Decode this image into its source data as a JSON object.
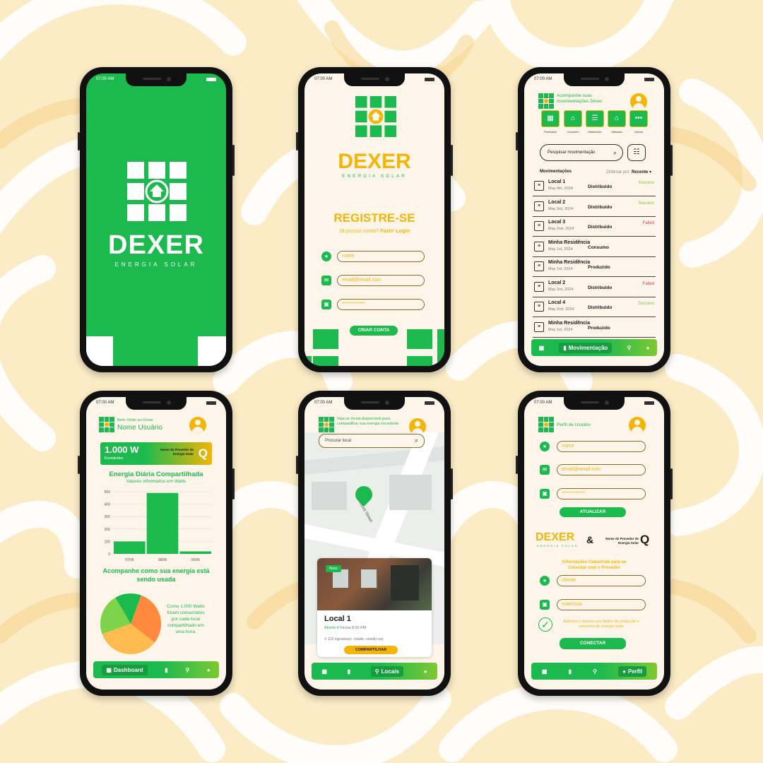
{
  "colors": {
    "brand_green": "#1cba4e",
    "brand_yellow": "#f3b506",
    "background": "#fdf3dd"
  },
  "status": {
    "time": "07:00 AM"
  },
  "splash": {
    "logo_text": "DEXER",
    "logo_sub": "ENERGIA SOLAR"
  },
  "register": {
    "logo_text": "DEXER",
    "logo_sub": "ENERGIA SOLAR",
    "title": "REGISTRE-SE",
    "subtitle_q": "Já possui conta?",
    "subtitle_link": "Fazer Login",
    "fields": {
      "name": "nome",
      "email": "email@email.com",
      "password": "************"
    },
    "button": "CRIAR CONTA"
  },
  "movements": {
    "header": "Acompanhe suas movimentações Dexer",
    "categories": [
      "Produzido",
      "Consumo",
      "Distribuído",
      "Utilizado",
      "Outros"
    ],
    "search_placeholder": "Pesquisar movimentação",
    "list_title": "Movimentações",
    "sort_label": "Ordenar por:",
    "sort_value": "Recente",
    "rows": [
      {
        "name": "Local 1",
        "date": "May 4th, 2024",
        "type": "Distribuido",
        "status": "Success",
        "status_color": "#7dc932"
      },
      {
        "name": "Local 2",
        "date": "May 3rd, 2024",
        "type": "Distribuido",
        "status": "Success",
        "status_color": "#7dc932"
      },
      {
        "name": "Local 3",
        "date": "May 2nd, 2024",
        "type": "Distribuido",
        "status": "Failed",
        "status_color": "#e53935"
      },
      {
        "name": "Minha Residência",
        "date": "May 1st, 2024",
        "type": "Consumo",
        "status": "",
        "status_color": ""
      },
      {
        "name": "Minha Residência",
        "date": "May 1st, 2024",
        "type": "Produzido",
        "status": "",
        "status_color": ""
      },
      {
        "name": "Local 2",
        "date": "May 3rd, 2024",
        "type": "Distribuido",
        "status": "Failed",
        "status_color": "#e53935"
      },
      {
        "name": "Local 4",
        "date": "May 2nd, 2024",
        "type": "Distribuido",
        "status": "Success",
        "status_color": "#7dc932"
      },
      {
        "name": "Minha Residência",
        "date": "May 1st, 2024",
        "type": "Produzido",
        "status": "",
        "status_color": ""
      }
    ],
    "nav_active": "Movimentação"
  },
  "dashboard": {
    "welcome": "Bem-Vindo ao Dexer",
    "user": "Nome Usuário",
    "card_value": "1.000 W",
    "card_sub": "Excedentes",
    "provider": "Nome do Provedor de Energia Solar",
    "chart_title": "Energia Diária Compartilhada",
    "chart_sub": "Valores informados em Watts",
    "section2": "Acompanhe como sua energia está sendo usada",
    "pie_text": "Como 1.000 Watts foram consumidos por cada local compartilhado em uma hora.",
    "nav_active": "Dashboard"
  },
  "chart_data": [
    {
      "type": "bar",
      "categories": [
        "07/06",
        "08/06",
        "09/06"
      ],
      "values": [
        100,
        490,
        20
      ],
      "ylim": [
        0,
        500
      ],
      "yticks": [
        0,
        100,
        200,
        300,
        400,
        500
      ],
      "title": "Energia Diária Compartilhada",
      "subtitle": "Valores informados em Watts"
    },
    {
      "type": "pie",
      "values": [
        30,
        34,
        22,
        14
      ],
      "colors": [
        "#ff8a3d",
        "#ffbb4f",
        "#7dd34a",
        "#1cba4e"
      ]
    }
  ],
  "locals": {
    "header": "Veja os locais disponíveis para compartilhar sua energia excedente",
    "search_placeholder": "Procurar local",
    "map_labels": [
      "Block Street"
    ],
    "badge": "Novo",
    "name": "Local 1",
    "open": "Aberto",
    "hours": "Fecha 8:00 PM",
    "address": "123 logradouro, cidade, estado cep",
    "button": "COMPARTILHAR",
    "nav_active": "Locais"
  },
  "profile": {
    "header": "Perfil de Usuário",
    "fields": {
      "name": "nome",
      "email": "email@email.com",
      "password": "************"
    },
    "update": "ATUALIZAR",
    "provider": "Nome do Provedor de Energia Solar",
    "info": "Informações Cadastrais para se Conectar com o Provedor",
    "client": "cliente",
    "registration": "matrícula",
    "authorize": "Autorizo o acesso aos dados de produção e consumo de energia solar",
    "connect": "CONECTAR",
    "nav_active": "Perfil"
  }
}
